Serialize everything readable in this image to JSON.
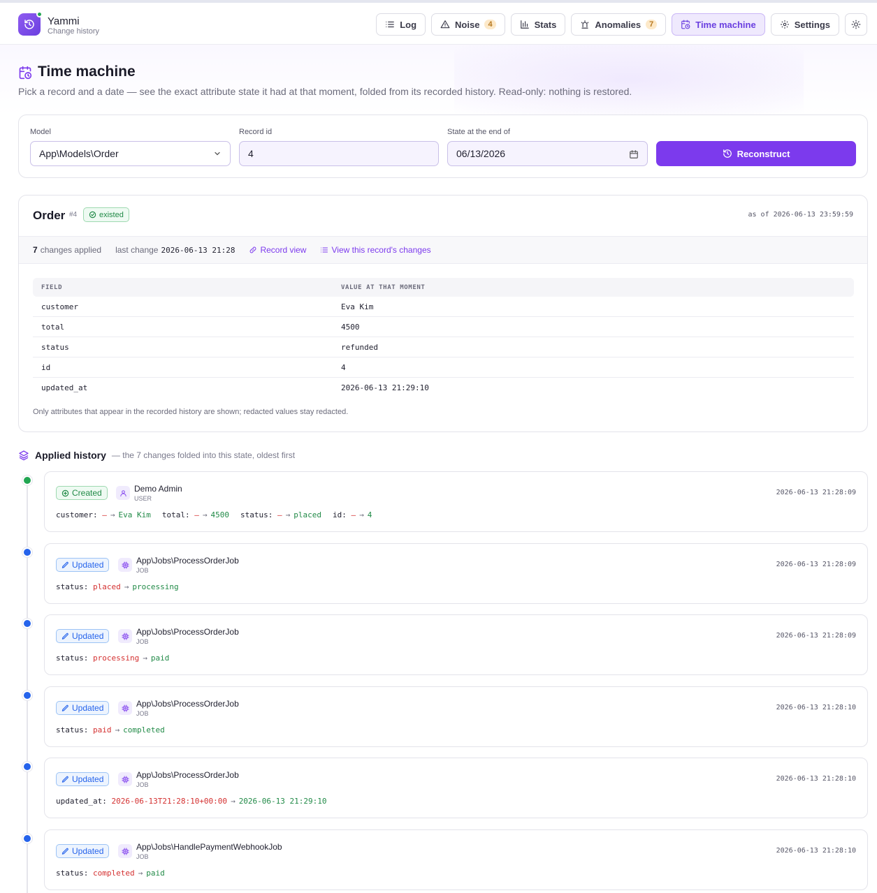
{
  "app": {
    "name": "Yammi",
    "subtitle": "Change history"
  },
  "nav": [
    {
      "label": "Log",
      "icon": "list-icon"
    },
    {
      "label": "Noise",
      "icon": "warning-icon",
      "count": "4"
    },
    {
      "label": "Stats",
      "icon": "bar-chart-icon"
    },
    {
      "label": "Anomalies",
      "icon": "siren-icon",
      "count": "7"
    },
    {
      "label": "Time machine",
      "icon": "calendar-clock-icon",
      "active": true
    },
    {
      "label": "Settings",
      "icon": "gear-icon"
    }
  ],
  "page": {
    "title": "Time machine",
    "description": "Pick a record and a date — see the exact attribute state it had at that moment, folded from its recorded history. Read-only: nothing is restored."
  },
  "form": {
    "model_label": "Model",
    "model_value": "App\\Models\\Order",
    "record_label": "Record id",
    "record_value": "4",
    "date_label": "State at the end of",
    "date_value": "06/13/2026",
    "button_label": "Reconstruct"
  },
  "record": {
    "title": "Order",
    "id_tag": "#4",
    "status_badge": "existed",
    "as_of": "as of 2026-06-13 23:59:59",
    "changes_count": "7",
    "changes_text": "changes applied",
    "last_change_label": "last change",
    "last_change_value": "2026-06-13 21:28",
    "record_view_link": "Record view",
    "view_changes_link": "View this record's changes",
    "table_headers": [
      "FIELD",
      "VALUE AT THAT MOMENT"
    ],
    "rows": [
      {
        "field": "customer",
        "value": "Eva Kim"
      },
      {
        "field": "total",
        "value": "4500"
      },
      {
        "field": "status",
        "value": "refunded"
      },
      {
        "field": "id",
        "value": "4"
      },
      {
        "field": "updated_at",
        "value": "2026-06-13 21:29:10"
      }
    ],
    "note": "Only attributes that appear in the recorded history are shown; redacted values stay redacted."
  },
  "history": {
    "title": "Applied history",
    "subtitle": "— the 7 changes folded into this state, oldest first",
    "colors": {
      "created": "#22a652",
      "updated": "#2563eb"
    },
    "items": [
      {
        "kind": "created",
        "badge": "Created",
        "actor": "Demo Admin",
        "actor_type": "USER",
        "actor_icon": "user-icon",
        "time": "2026-06-13 21:28:09",
        "changes": [
          {
            "field": "customer:",
            "old": "—",
            "new": "Eva Kim"
          },
          {
            "field": "total:",
            "old": "—",
            "new": "4500"
          },
          {
            "field": "status:",
            "old": "—",
            "new": "placed"
          },
          {
            "field": "id:",
            "old": "—",
            "new": "4"
          }
        ]
      },
      {
        "kind": "updated",
        "badge": "Updated",
        "actor": "App\\Jobs\\ProcessOrderJob",
        "actor_type": "JOB",
        "actor_icon": "cpu-icon",
        "time": "2026-06-13 21:28:09",
        "changes": [
          {
            "field": "status:",
            "old": "placed",
            "new": "processing"
          }
        ]
      },
      {
        "kind": "updated",
        "badge": "Updated",
        "actor": "App\\Jobs\\ProcessOrderJob",
        "actor_type": "JOB",
        "actor_icon": "cpu-icon",
        "time": "2026-06-13 21:28:09",
        "changes": [
          {
            "field": "status:",
            "old": "processing",
            "new": "paid"
          }
        ]
      },
      {
        "kind": "updated",
        "badge": "Updated",
        "actor": "App\\Jobs\\ProcessOrderJob",
        "actor_type": "JOB",
        "actor_icon": "cpu-icon",
        "time": "2026-06-13 21:28:10",
        "changes": [
          {
            "field": "status:",
            "old": "paid",
            "new": "completed"
          }
        ]
      },
      {
        "kind": "updated",
        "badge": "Updated",
        "actor": "App\\Jobs\\ProcessOrderJob",
        "actor_type": "JOB",
        "actor_icon": "cpu-icon",
        "time": "2026-06-13 21:28:10",
        "changes": [
          {
            "field": "updated_at:",
            "old": "2026-06-13T21:28:10+00:00",
            "new": "2026-06-13 21:29:10"
          }
        ]
      },
      {
        "kind": "updated",
        "badge": "Updated",
        "actor": "App\\Jobs\\HandlePaymentWebhookJob",
        "actor_type": "JOB",
        "actor_icon": "cpu-icon",
        "time": "2026-06-13 21:28:10",
        "changes": [
          {
            "field": "status:",
            "old": "completed",
            "new": "paid"
          }
        ]
      }
    ]
  }
}
